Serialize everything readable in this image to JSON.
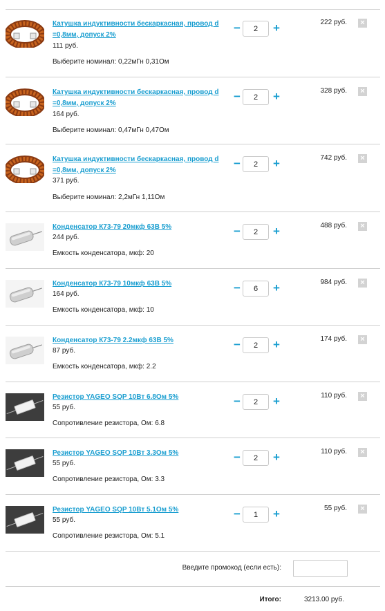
{
  "cart": {
    "items": [
      {
        "title": "Катушка индуктивности бескаркасная, провод d =0,8мм, допуск 2%",
        "unit_price": "111 руб.",
        "option": "Выберите номинал: 0,22мГн 0,31Ом",
        "qty": "2",
        "total": "222 руб.",
        "thumb_icon": "inductor-coil-icon"
      },
      {
        "title": "Катушка индуктивности бескаркасная, провод d =0,8мм, допуск 2%",
        "unit_price": "164 руб.",
        "option": "Выберите номинал: 0,47мГн 0,47Ом",
        "qty": "2",
        "total": "328 руб.",
        "thumb_icon": "inductor-coil-icon"
      },
      {
        "title": "Катушка индуктивности бескаркасная, провод d =0,8мм, допуск 2%",
        "unit_price": "371 руб.",
        "option": "Выберите номинал: 2,2мГн 1,11Ом",
        "qty": "2",
        "total": "742 руб.",
        "thumb_icon": "inductor-coil-icon"
      },
      {
        "title": "Конденсатор К73-79 20мкф 63В 5%",
        "unit_price": "244 руб.",
        "option": "Емкость конденсатора, мкф: 20",
        "qty": "2",
        "total": "488 руб.",
        "thumb_icon": "capacitor-icon"
      },
      {
        "title": "Конденсатор К73-79 10мкф 63В 5%",
        "unit_price": "164 руб.",
        "option": "Емкость конденсатора, мкф: 10",
        "qty": "6",
        "total": "984 руб.",
        "thumb_icon": "capacitor-icon"
      },
      {
        "title": "Конденсатор К73-79 2.2мкф 63В 5%",
        "unit_price": "87 руб.",
        "option": "Емкость конденсатора, мкф: 2.2",
        "qty": "2",
        "total": "174 руб.",
        "thumb_icon": "capacitor-icon"
      },
      {
        "title": "Резистор YAGEO SQP 10Вт 6.8Ом 5%",
        "unit_price": "55 руб.",
        "option": "Сопротивление резистора, Ом: 6.8",
        "qty": "2",
        "total": "110 руб.",
        "thumb_icon": "resistor-icon"
      },
      {
        "title": "Резистор YAGEO SQP 10Вт 3.3Ом 5%",
        "unit_price": "55 руб.",
        "option": "Сопротивление резистора, Ом: 3.3",
        "qty": "2",
        "total": "110 руб.",
        "thumb_icon": "resistor-icon"
      },
      {
        "title": "Резистор YAGEO SQP 10Вт 5.1Ом 5%",
        "unit_price": "55 руб.",
        "option": "Сопротивление резистора, Ом: 5.1",
        "qty": "1",
        "total": "55 руб.",
        "thumb_icon": "resistor-icon"
      }
    ],
    "minus_label": "−",
    "plus_label": "+",
    "remove_label": "×"
  },
  "promo": {
    "label": "Введите промокод (если есть):",
    "value": ""
  },
  "summary": {
    "label": "Итого:",
    "value": "3213.00 руб."
  },
  "colors": {
    "link": "#1a9ed0",
    "divider": "#cfcfcf",
    "remove_bg": "#d3d3d3"
  }
}
